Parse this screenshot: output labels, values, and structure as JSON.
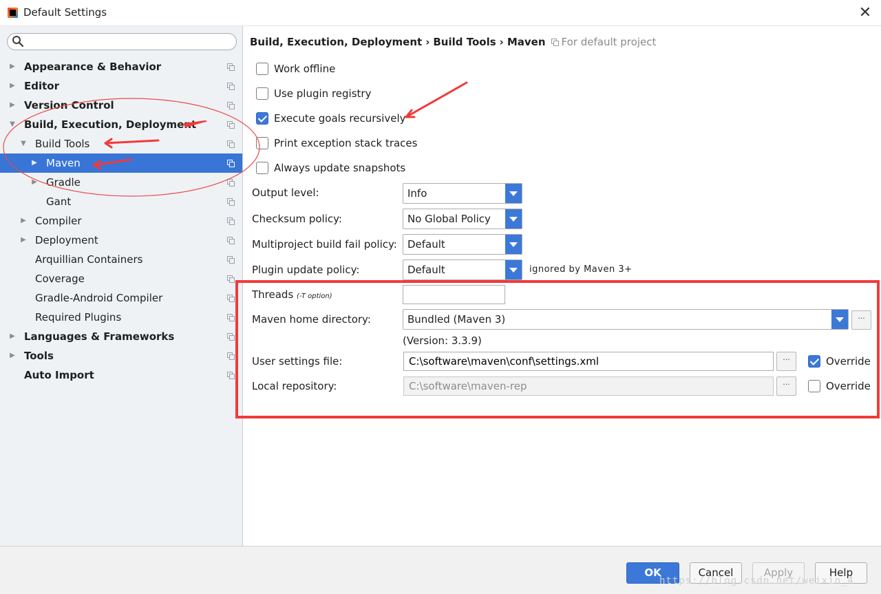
{
  "window": {
    "title": "Default Settings",
    "close_glyph": "✕"
  },
  "sidebar": {
    "search": {
      "value": "",
      "placeholder": ""
    },
    "items": [
      {
        "label": "Appearance & Behavior",
        "bold": true,
        "arrow": "right",
        "selected": false
      },
      {
        "label": "Editor",
        "bold": true,
        "arrow": "right",
        "selected": false
      },
      {
        "label": "Version Control",
        "bold": true,
        "arrow": "right",
        "selected": false
      },
      {
        "label": "Build, Execution, Deployment",
        "bold": true,
        "arrow": "down",
        "selected": false
      },
      {
        "label": "Build Tools",
        "bold": false,
        "arrow": "down",
        "selected": false
      },
      {
        "label": "Maven",
        "bold": false,
        "arrow": "right",
        "selected": true
      },
      {
        "label": "Gradle",
        "bold": false,
        "arrow": "right",
        "selected": false
      },
      {
        "label": "Gant",
        "bold": false,
        "arrow": "none",
        "selected": false
      },
      {
        "label": "Compiler",
        "bold": false,
        "arrow": "right",
        "selected": false
      },
      {
        "label": "Deployment",
        "bold": false,
        "arrow": "right",
        "selected": false
      },
      {
        "label": "Arquillian Containers",
        "bold": false,
        "arrow": "none",
        "selected": false
      },
      {
        "label": "Coverage",
        "bold": false,
        "arrow": "none",
        "selected": false
      },
      {
        "label": "Gradle-Android Compiler",
        "bold": false,
        "arrow": "none",
        "selected": false
      },
      {
        "label": "Required Plugins",
        "bold": false,
        "arrow": "none",
        "selected": false
      },
      {
        "label": "Languages & Frameworks",
        "bold": true,
        "arrow": "right",
        "selected": false
      },
      {
        "label": "Tools",
        "bold": true,
        "arrow": "right",
        "selected": false
      },
      {
        "label": "Auto Import",
        "bold": true,
        "arrow": "none",
        "selected": false
      }
    ]
  },
  "breadcrumb": {
    "parts": [
      "Build, Execution, Deployment",
      "Build Tools",
      "Maven"
    ],
    "separator": "›",
    "scope": "For default project"
  },
  "options": {
    "work_offline": {
      "label": "Work offline",
      "checked": false
    },
    "use_plugin_registry": {
      "label": "Use plugin registry",
      "checked": false
    },
    "execute_goals_recursively": {
      "label": "Execute goals recursively",
      "checked": true
    },
    "print_exception_stack_traces": {
      "label": "Print exception stack traces",
      "checked": false
    },
    "always_update_snapshots": {
      "label": "Always update snapshots",
      "checked": false
    }
  },
  "form": {
    "output_level": {
      "label": "Output level:",
      "value": "Info"
    },
    "checksum_policy": {
      "label": "Checksum policy:",
      "value": "No Global Policy"
    },
    "multiproject_fail_policy": {
      "label": "Multiproject build fail policy:",
      "value": "Default"
    },
    "plugin_update_policy": {
      "label": "Plugin update policy:",
      "value": "Default",
      "note": "ignored by Maven 3+"
    },
    "threads": {
      "label": "Threads",
      "hint": "(-T option)",
      "value": ""
    },
    "maven_home": {
      "label": "Maven home directory:",
      "value": "Bundled (Maven 3)",
      "version": "(Version: 3.3.9)"
    },
    "user_settings": {
      "label": "User settings file:",
      "value": "C:\\software\\maven\\conf\\settings.xml",
      "override_label": "Override",
      "override_checked": true
    },
    "local_repository": {
      "label": "Local repository:",
      "value": "C:\\software\\maven-rep",
      "override_label": "Override",
      "override_checked": false
    },
    "browse_glyph": "···"
  },
  "footer": {
    "ok": "OK",
    "cancel": "Cancel",
    "apply": "Apply",
    "help": "Help",
    "watermark": "https://blog.csdn.net/weixin_4"
  },
  "colors": {
    "accent": "#3c78d8",
    "selection": "#3875d7",
    "annotation": "#f23a3a",
    "sidebar_bg": "#eff2f5"
  }
}
